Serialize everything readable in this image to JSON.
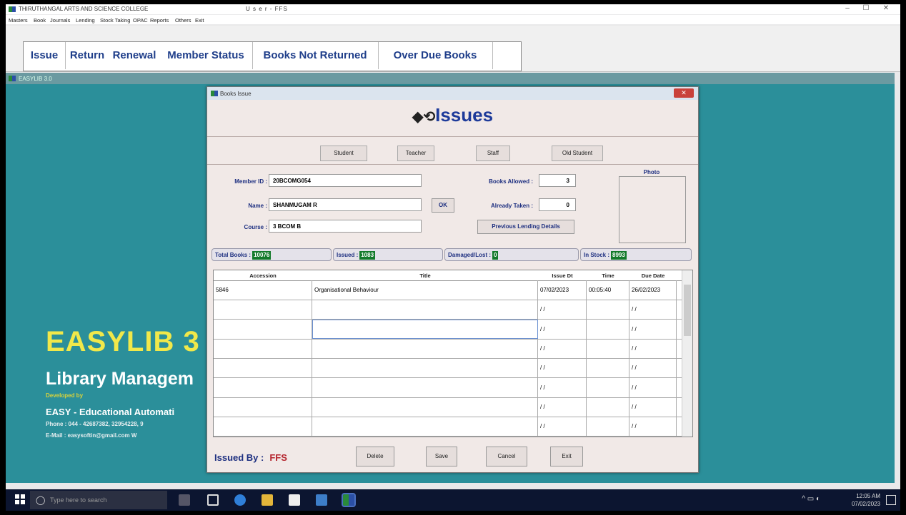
{
  "window": {
    "title": "THIRUTHANGAL ARTS AND SCIENCE COLLEGE",
    "user": "U s e r - FFS"
  },
  "menu": [
    "Masters",
    "Book",
    "Journals",
    "Lending",
    "Stock Taking",
    "OPAC",
    "Reports",
    "Others",
    "Exit"
  ],
  "toolbar": [
    "Issue",
    "Return",
    "Renewal",
    "Member Status",
    "Books Not Returned",
    "Over Due Books"
  ],
  "mdi_title": "EASYLIB 3.0",
  "brand": {
    "name": "EASYLIB 3",
    "subtitle": "Library Managem",
    "developed": "Developed by",
    "company_lead": "EASY",
    "company": " - Educational Automati",
    "phone": "Phone : 044 - 42687382, 32954228, 9",
    "email": "E-Mail : easysoftin@gmail.com  W"
  },
  "dialog": {
    "title": "Books Issue",
    "heading": "Issues",
    "member_types": [
      "Student",
      "Teacher",
      "Staff",
      "Old Student"
    ],
    "member_id_label": "Member ID :",
    "member_id": "20BCOMG054",
    "name_label": "Name :",
    "name": "SHANMUGAM R",
    "course_label": "Course :",
    "course": "3 BCOM B",
    "ok_label": "OK",
    "books_allowed_label": "Books Allowed :",
    "books_allowed": "3",
    "already_taken_label": "Already Taken :",
    "already_taken": "0",
    "prev_lending": "Previous Lending Details",
    "photo_label": "Photo",
    "stats": {
      "total_label": "Total Books :",
      "total": "10076",
      "issued_label": "Issued :",
      "issued": "1083",
      "damaged_label": "Damaged/Lost :",
      "damaged": "0",
      "stock_label": "In Stock :",
      "stock": "8993"
    },
    "grid": {
      "columns": [
        "Accession",
        "Title",
        "Issue Dt",
        "Time",
        "Due Date"
      ],
      "rows": [
        [
          "5846",
          "Organisational Behaviour",
          "07/02/2023",
          "00:05:40",
          "26/02/2023"
        ],
        [
          "",
          "",
          "/ /",
          "",
          "/ /"
        ],
        [
          "",
          "",
          "/ /",
          "",
          "/ /"
        ],
        [
          "",
          "",
          "/ /",
          "",
          "/ /"
        ],
        [
          "",
          "",
          "/ /",
          "",
          "/ /"
        ],
        [
          "",
          "",
          "/ /",
          "",
          "/ /"
        ],
        [
          "",
          "",
          "/ /",
          "",
          "/ /"
        ],
        [
          "",
          "",
          "/ /",
          "",
          "/ /"
        ]
      ]
    },
    "issued_by_label": "Issued By :",
    "issued_by": "FFS",
    "actions": [
      "Delete",
      "Save",
      "Cancel",
      "Exit"
    ]
  },
  "taskbar": {
    "search_placeholder": "Type here to search",
    "time": "12:05 AM",
    "date": "07/02/2023"
  },
  "colors": {
    "accent": "#1d3a9a",
    "desktop": "#2b8f9a",
    "brand_yellow": "#f1e84a"
  }
}
